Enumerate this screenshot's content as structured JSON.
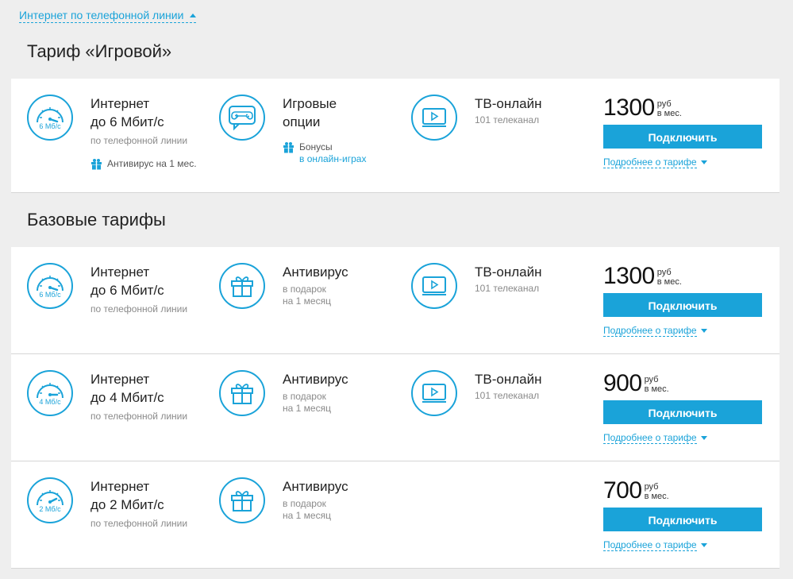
{
  "top_toggle": {
    "label": "Интернет по телефонной линии"
  },
  "game_section": {
    "title": "Тариф «Игровой»",
    "card": {
      "internet": {
        "speed_label": "6 Мб/с",
        "title1": "Интернет",
        "title2": "до 6 Мбит/с",
        "sub": "по телефонной линии",
        "bonus": "Антивирус на 1 мес."
      },
      "game": {
        "title1": "Игровые",
        "title2": "опции",
        "bonus1": "Бонусы",
        "bonus2": "в онлайн-играх"
      },
      "tv": {
        "title": "ТВ-онлайн",
        "sub": "101 телеканал"
      },
      "price": "1300",
      "unit1": "руб",
      "unit2": "в мес.",
      "button": "Подключить",
      "more": "Подробнее о тарифе"
    }
  },
  "base_section": {
    "title": "Базовые тарифы",
    "cards": [
      {
        "internet": {
          "speed_label": "6 Мб/с",
          "title1": "Интернет",
          "title2": "до 6 Мбит/с",
          "sub": "по телефонной линии"
        },
        "antivirus": {
          "title": "Антивирус",
          "sub1": "в подарок",
          "sub2": "на 1 месяц"
        },
        "tv": {
          "title": "ТВ-онлайн",
          "sub": "101 телеканал"
        },
        "price": "1300",
        "unit1": "руб",
        "unit2": "в мес.",
        "button": "Подключить",
        "more": "Подробнее о тарифе"
      },
      {
        "internet": {
          "speed_label": "4 Мб/с",
          "title1": "Интернет",
          "title2": "до 4 Мбит/с",
          "sub": "по телефонной линии"
        },
        "antivirus": {
          "title": "Антивирус",
          "sub1": "в подарок",
          "sub2": "на 1 месяц"
        },
        "tv": {
          "title": "ТВ-онлайн",
          "sub": "101 телеканал"
        },
        "price": "900",
        "unit1": "руб",
        "unit2": "в мес.",
        "button": "Подключить",
        "more": "Подробнее о тарифе"
      },
      {
        "internet": {
          "speed_label": "2 Мб/с",
          "title1": "Интернет",
          "title2": "до 2 Мбит/с",
          "sub": "по телефонной линии"
        },
        "antivirus": {
          "title": "Антивирус",
          "sub1": "в подарок",
          "sub2": "на 1 месяц"
        },
        "price": "700",
        "unit1": "руб",
        "unit2": "в мес.",
        "button": "Подключить",
        "more": "Подробнее о тарифе"
      }
    ]
  },
  "colors": {
    "accent": "#1aa3d9",
    "background": "#eeeeee",
    "card": "#ffffff"
  },
  "icons": [
    "speedometer-icon",
    "gamepad-icon",
    "tv-icon",
    "gift-icon",
    "caret-up-icon",
    "caret-down-icon"
  ]
}
